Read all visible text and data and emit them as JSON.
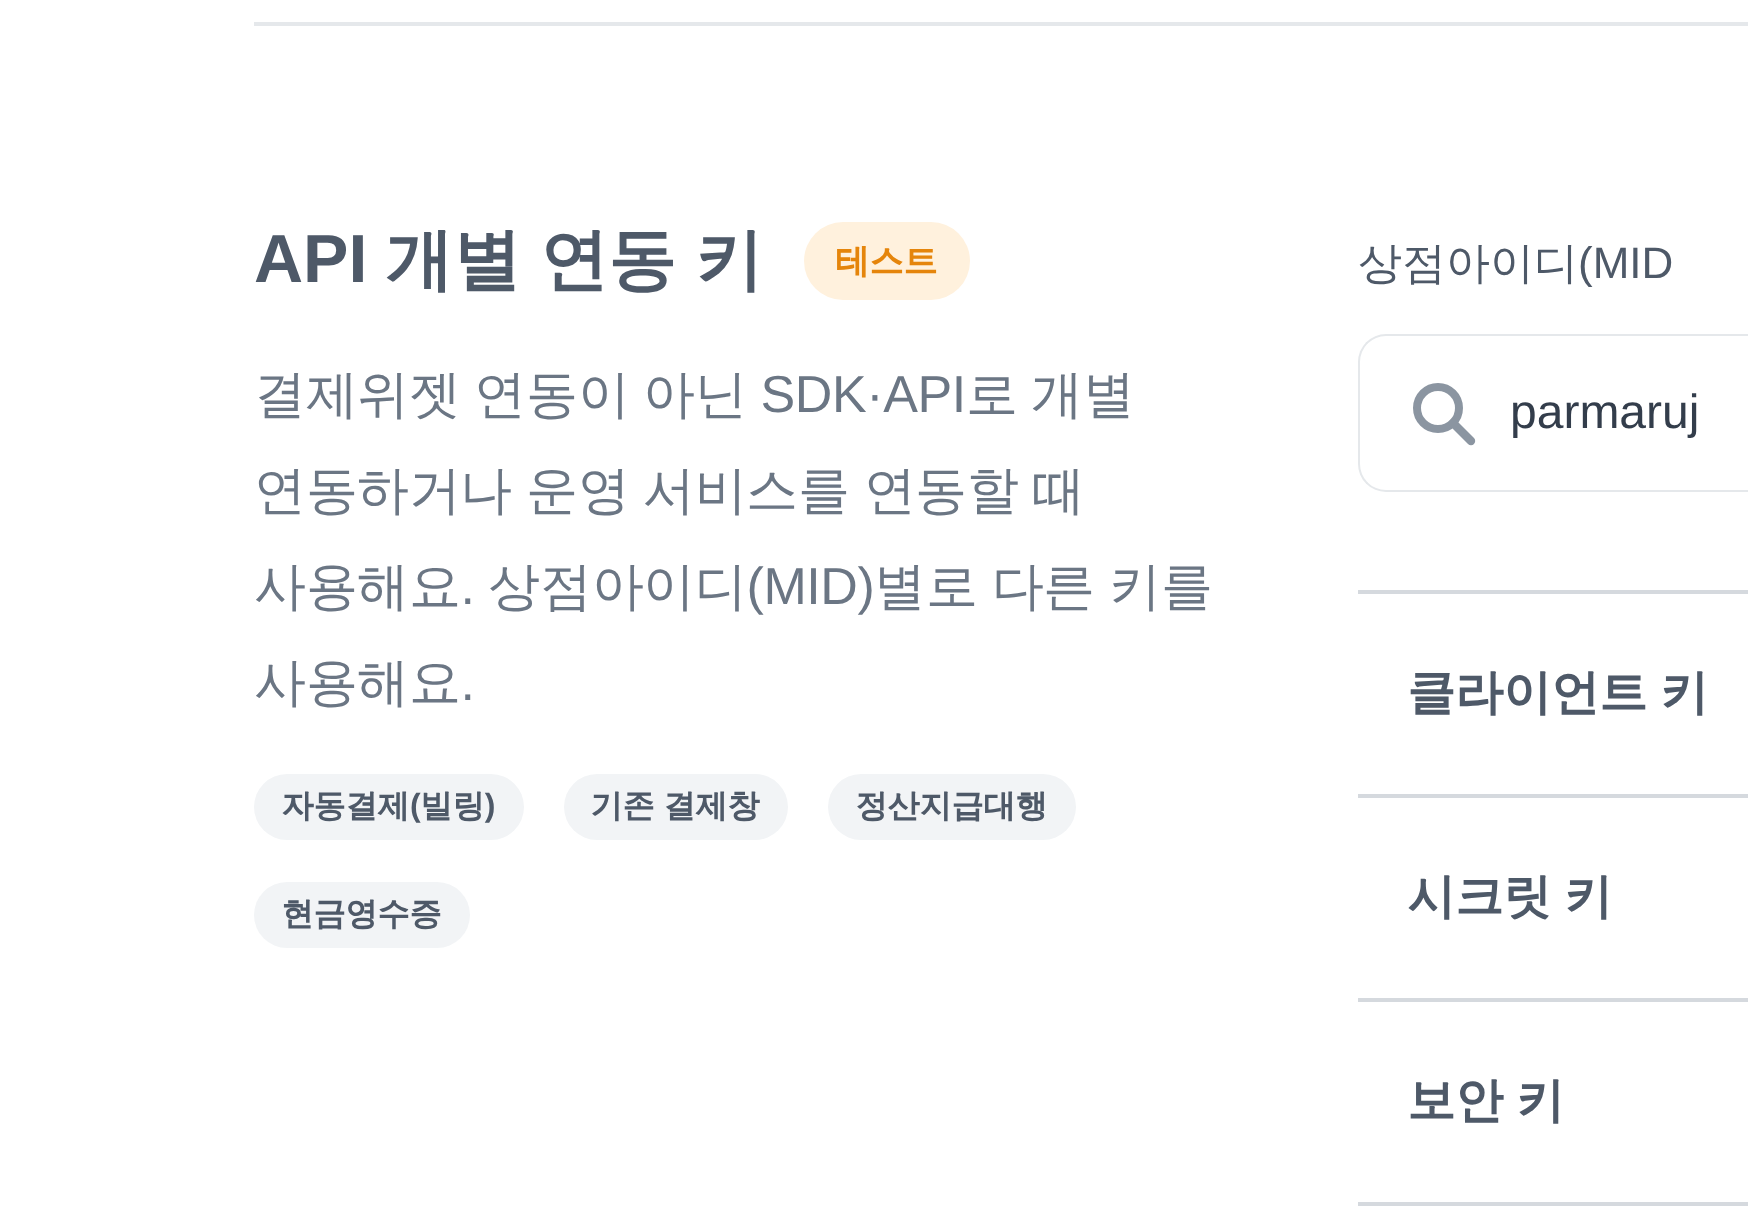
{
  "info": {
    "title": "API 개별 연동 키",
    "badge": "테스트",
    "description": "결제위젯 연동이 아닌 SDK·API로 개별 연동하거나 운영 서비스를 연동할 때 사용해요. 상점아이디(MID)별로 다른 키를 사용해요.",
    "tags": [
      "자동결제(빌링)",
      "기존 결제창",
      "정산지급대행",
      "현금영수증"
    ]
  },
  "merchant": {
    "label": "상점아이디(MID",
    "search": {
      "value": "parmaruj"
    }
  },
  "keys": [
    {
      "label": "클라이언트 키"
    },
    {
      "label": "시크릿 키"
    },
    {
      "label": "보안 키"
    }
  ]
}
